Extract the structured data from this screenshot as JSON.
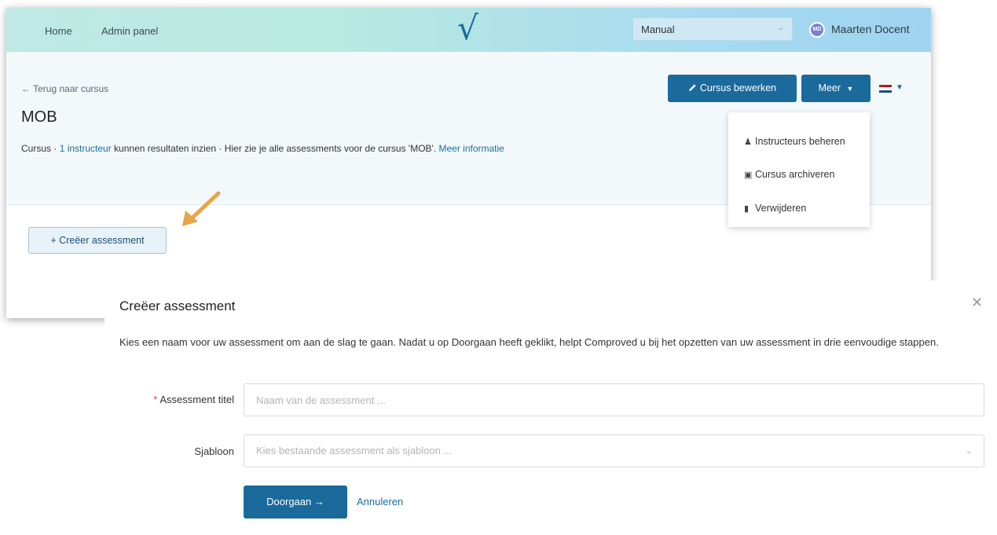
{
  "nav": {
    "home": "Home",
    "admin": "Admin panel",
    "logo": "√",
    "mode_select": "Manual",
    "avatar_initials": "MD",
    "user_name": "Maarten Docent"
  },
  "course": {
    "back_link": "← Terug naar cursus",
    "title": "MOB",
    "desc_prefix": "Cursus · ",
    "desc_instructor_link": "1 instructeur",
    "desc_middle": " kunnen resultaten inzien · Hier zie je alle assessments voor de cursus 'MOB'.  ",
    "desc_more_link": "Meer informatie",
    "edit_button": "Cursus bewerken",
    "more_button": "Meer",
    "create_button": "+ Creëer assessment"
  },
  "dropdown": {
    "items": [
      {
        "icon": "users-icon",
        "label": "Instructeurs beheren"
      },
      {
        "icon": "archive-icon",
        "label": "Cursus archiveren"
      },
      {
        "icon": "trash-icon",
        "label": "Verwijderen"
      }
    ]
  },
  "modal": {
    "title": "Creëer assessment",
    "intro": "Kies een naam voor uw assessment om aan de slag te gaan. Nadat u op Doorgaan heeft geklikt, helpt Comproved u bij het opzetten van uw assessment in drie eenvoudige stappen.",
    "title_label": "Assessment titel",
    "title_placeholder": "Naam van de assessment ...",
    "template_label": "Sjabloon",
    "template_placeholder": "Kies bestaande assessment als sjabloon ...",
    "continue_button": "Doorgaan →",
    "cancel_link": "Annuleren"
  },
  "colors": {
    "primary": "#1b6a9c",
    "arrow": "#e8a447",
    "required": "#e0392b"
  }
}
